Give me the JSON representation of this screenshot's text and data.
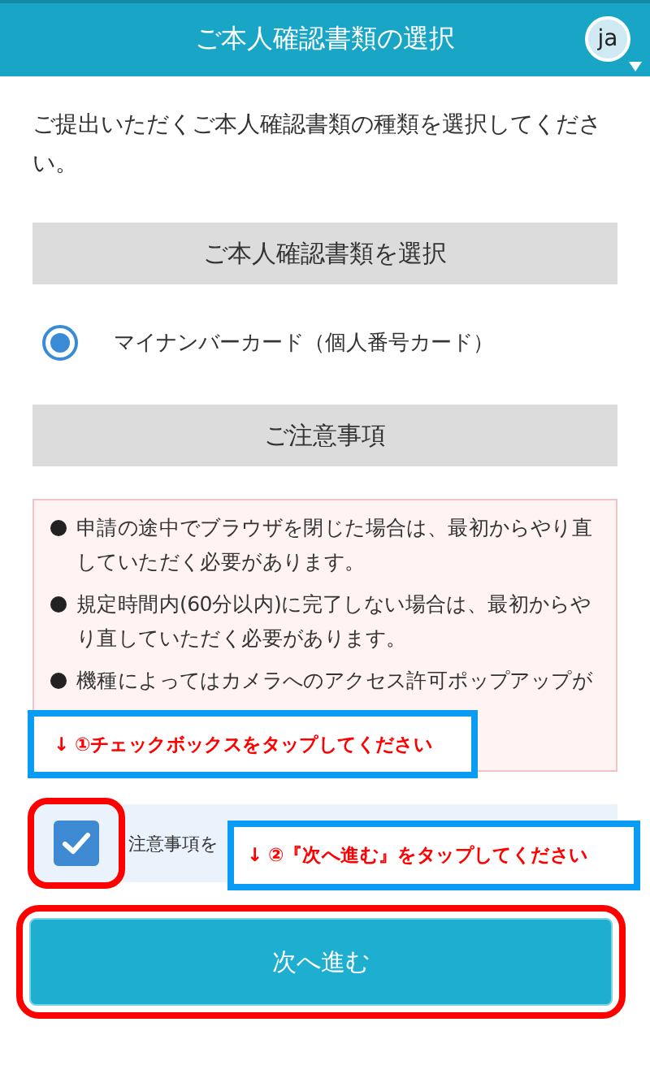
{
  "header": {
    "title": "ご本人確認書類の選択",
    "avatar": "ja"
  },
  "intro": "ご提出いただくご本人確認書類の種類を選択してください。",
  "document_section": {
    "heading": "ご本人確認書類を選択",
    "options": [
      {
        "label": "マイナンバーカード（個人番号カード）",
        "selected": true
      }
    ]
  },
  "notice_section": {
    "heading": "ご注意事項",
    "items": [
      "申請の途中でブラウザを閉じた場合は、最初からやり直していただく必要があります。",
      "規定時間内(60分以内)に完了しない場合は、最初からやり直していただく必要があります。",
      "機種によってはカメラへのアクセス許可ポップアップが"
    ]
  },
  "agreement": {
    "label": "注意事項を",
    "checked": true
  },
  "next_button": "次へ進む",
  "annotations": [
    {
      "text": "↓ ①チェックボックスをタップしてください"
    },
    {
      "text": "↓ ②『次へ進む』をタップしてください"
    }
  ]
}
